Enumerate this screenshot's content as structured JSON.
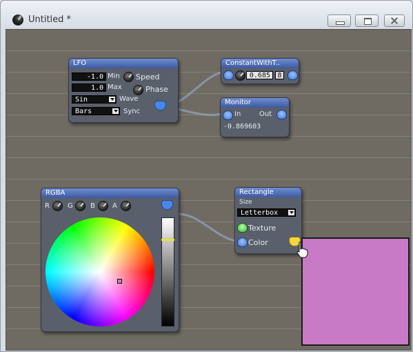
{
  "window": {
    "title": "Untitled *"
  },
  "colors": {
    "canvas": "#6f6b63",
    "node_body": "#5a5f6c",
    "node_title": "#4a6bb8",
    "port": "#4a86ea",
    "swatch": "#c87ac6"
  },
  "lfo": {
    "title": "LFO",
    "min_value": "-1.0",
    "min_label": "Min",
    "speed_label": "Speed",
    "max_value": "1.0",
    "max_label": "Max",
    "phase_label": "Phase",
    "wave_value": "Sin",
    "wave_label": "Wave",
    "sync_value": "Bars",
    "sync_label": "Sync"
  },
  "constant": {
    "title": "ConstantWithT..",
    "value": "0.685",
    "toggle": "8"
  },
  "monitor": {
    "title": "Monitor",
    "in_label": "In",
    "out_label": "Out",
    "value": "-0.869603"
  },
  "rgba": {
    "title": "RGBA",
    "r_label": "R",
    "g_label": "G",
    "b_label": "B",
    "a_label": "A"
  },
  "rectangle": {
    "title": "Rectangle",
    "size_label": "Size",
    "size_value": "Letterbox",
    "texture_label": "Texture",
    "color_label": "Color"
  },
  "icons": [
    "app-icon",
    "minimize-icon",
    "maximize-icon",
    "close-icon",
    "knob-icon",
    "port-icon",
    "hand-cursor-icon"
  ]
}
